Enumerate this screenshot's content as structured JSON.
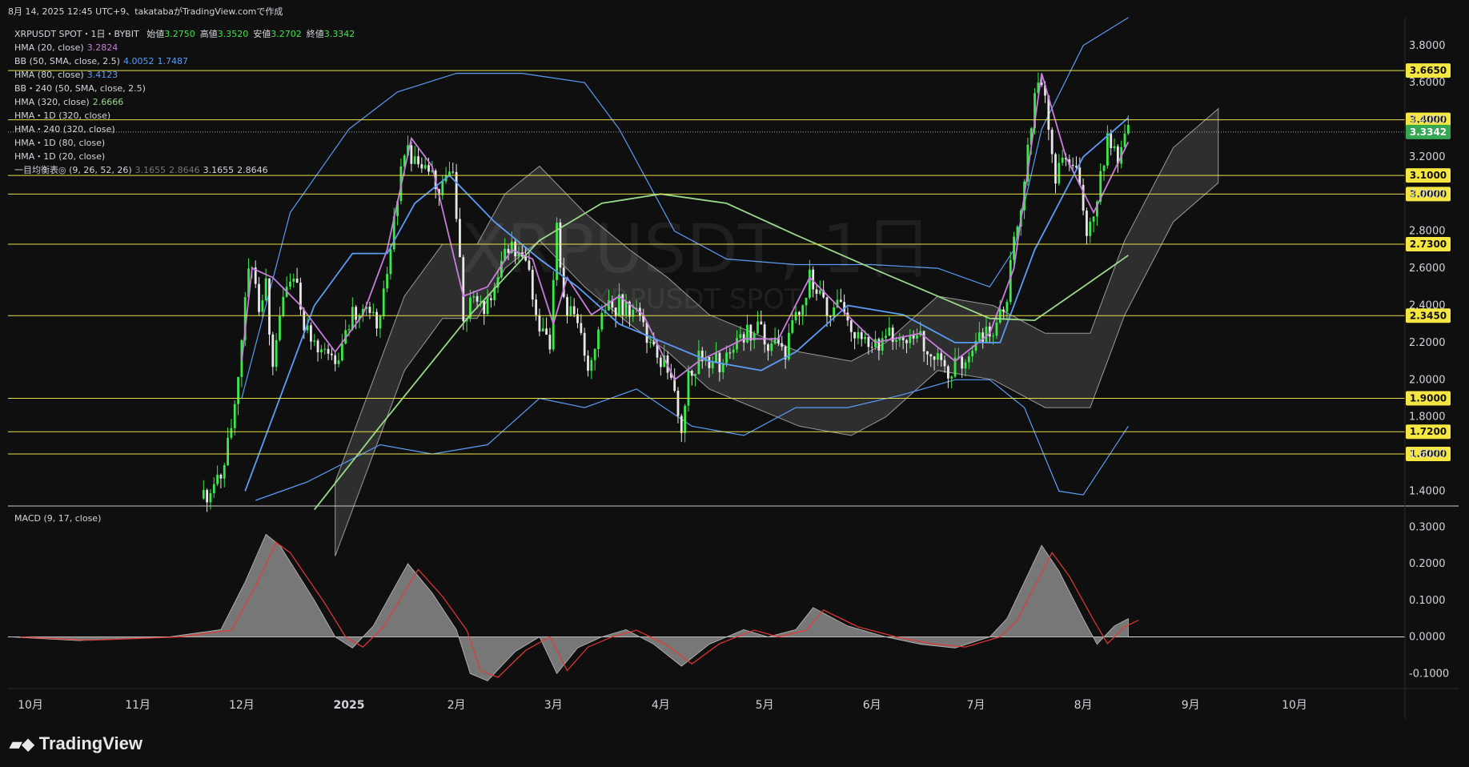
{
  "header": {
    "info_line": "8月 14, 2025 12:45 UTC+9、takatabaがTradingView.comで作成"
  },
  "legend": {
    "symbol": "XRPUSDT SPOT・1日・BYBIT",
    "ohlc": [
      {
        "label": "始値",
        "value": "3.2750"
      },
      {
        "label": "高値",
        "value": "3.3520"
      },
      {
        "label": "安値",
        "value": "3.2702"
      },
      {
        "label": "終値",
        "value": "3.3342"
      }
    ],
    "indicators": [
      {
        "label": "HMA (20, close)",
        "values": [
          "3.2824"
        ],
        "colors": [
          "#c77ddb"
        ]
      },
      {
        "label": "BB (50, SMA, close, 2.5)",
        "values": [
          "4.0052",
          "1.7487"
        ],
        "colors": [
          "#5b9cf6",
          "#5b9cf6"
        ]
      },
      {
        "label": "HMA (80, close)",
        "values": [
          "3.4123"
        ],
        "colors": [
          "#5b9cf6"
        ]
      },
      {
        "label": "BB・240 (50, SMA, close, 2.5)",
        "values": [],
        "colors": []
      },
      {
        "label": "HMA (320, close)",
        "values": [
          "2.6666"
        ],
        "colors": [
          "#9ad88a"
        ]
      },
      {
        "label": "HMA・1D (320, close)",
        "values": [],
        "colors": []
      },
      {
        "label": "HMA・240 (320, close)",
        "values": [],
        "colors": []
      },
      {
        "label": "HMA・1D (80, close)",
        "values": [],
        "colors": []
      },
      {
        "label": "HMA・1D (20, close)",
        "values": [],
        "colors": []
      },
      {
        "label": "一目均衡表◎ (9, 26, 52, 26)",
        "values": [
          "3.1655",
          "2.8646",
          "3.1655",
          "2.8646"
        ],
        "colors": [
          "#777777",
          "#777777",
          "#d1d4dc",
          "#d1d4dc"
        ]
      }
    ]
  },
  "watermark": {
    "main": "XRPUSDT, 1日",
    "sub": "XRPUSDT SPOT"
  },
  "macd": {
    "title": "MACD (9, 17, close)"
  },
  "brand": "TradingView",
  "colors": {
    "background": "#0f0f0f",
    "up_candle": "#3ce84a",
    "down_candle": "#e8e8e8",
    "hma20": "#c77ddb",
    "hma80": "#5b9cf6",
    "bb": "#5b9cf6",
    "hma320": "#9ad88a",
    "level_line": "#e8e04a",
    "level_tag_bg": "#f5e642",
    "last_price_bg": "#34a853",
    "macd_fill": "#8a8a8a",
    "macd_signal": "#e53935"
  },
  "chart_data": {
    "type": "candlestick",
    "symbol": "XRPUSDT SPOT",
    "interval": "1日",
    "exchange": "BYBIT",
    "y_range": [
      1.32,
      3.95
    ],
    "y_ticks": [
      "3.8000",
      "3.6000",
      "3.4000",
      "3.2000",
      "3.0000",
      "2.8000",
      "2.6000",
      "2.4000",
      "2.2000",
      "2.0000",
      "1.8000",
      "1.6000",
      "1.4000"
    ],
    "x_ticks": [
      {
        "label": "10月",
        "date": "2024-10-01",
        "bold": false
      },
      {
        "label": "11月",
        "date": "2024-11-01",
        "bold": false
      },
      {
        "label": "12月",
        "date": "2024-12-01",
        "bold": false
      },
      {
        "label": "2025",
        "date": "2025-01-01",
        "bold": true
      },
      {
        "label": "2月",
        "date": "2025-02-01",
        "bold": false
      },
      {
        "label": "3月",
        "date": "2025-03-01",
        "bold": false
      },
      {
        "label": "4月",
        "date": "2025-04-01",
        "bold": false
      },
      {
        "label": "5月",
        "date": "2025-05-01",
        "bold": false
      },
      {
        "label": "6月",
        "date": "2025-06-01",
        "bold": false
      },
      {
        "label": "7月",
        "date": "2025-07-01",
        "bold": false
      },
      {
        "label": "8月",
        "date": "2025-08-01",
        "bold": false
      },
      {
        "label": "9月",
        "date": "2025-09-01",
        "bold": false
      },
      {
        "label": "10月",
        "date": "2025-10-01",
        "bold": false
      }
    ],
    "levels": [
      "3.6650",
      "3.4000",
      "3.1000",
      "3.0000",
      "2.7300",
      "2.3450",
      "1.9000",
      "1.7200",
      "1.6000"
    ],
    "last_price": "3.3342",
    "close_path": [
      [
        "2024-11-20",
        1.36
      ],
      [
        "2024-11-24",
        1.45
      ],
      [
        "2024-11-28",
        1.7
      ],
      [
        "2024-12-02",
        2.45
      ],
      [
        "2024-12-04",
        2.65
      ],
      [
        "2024-12-06",
        2.35
      ],
      [
        "2024-12-08",
        2.5
      ],
      [
        "2024-12-10",
        2.1
      ],
      [
        "2024-12-13",
        2.4
      ],
      [
        "2024-12-16",
        2.55
      ],
      [
        "2024-12-19",
        2.3
      ],
      [
        "2024-12-22",
        2.2
      ],
      [
        "2024-12-26",
        2.15
      ],
      [
        "2024-12-29",
        2.08
      ],
      [
        "2025-01-02",
        2.35
      ],
      [
        "2025-01-06",
        2.4
      ],
      [
        "2025-01-09",
        2.3
      ],
      [
        "2025-01-12",
        2.55
      ],
      [
        "2025-01-15",
        3.0
      ],
      [
        "2025-01-17",
        3.25
      ],
      [
        "2025-01-20",
        3.15
      ],
      [
        "2025-01-24",
        3.1
      ],
      [
        "2025-01-27",
        3.05
      ],
      [
        "2025-01-31",
        3.08
      ],
      [
        "2025-02-02",
        2.6
      ],
      [
        "2025-02-03",
        2.35
      ],
      [
        "2025-02-06",
        2.45
      ],
      [
        "2025-02-10",
        2.4
      ],
      [
        "2025-02-13",
        2.55
      ],
      [
        "2025-02-16",
        2.7
      ],
      [
        "2025-02-19",
        2.68
      ],
      [
        "2025-02-22",
        2.55
      ],
      [
        "2025-02-25",
        2.25
      ],
      [
        "2025-02-28",
        2.15
      ],
      [
        "2025-03-02",
        2.85
      ],
      [
        "2025-03-04",
        2.4
      ],
      [
        "2025-03-08",
        2.3
      ],
      [
        "2025-03-11",
        2.05
      ],
      [
        "2025-03-14",
        2.3
      ],
      [
        "2025-03-18",
        2.4
      ],
      [
        "2025-03-22",
        2.4
      ],
      [
        "2025-03-26",
        2.35
      ],
      [
        "2025-03-30",
        2.15
      ],
      [
        "2025-04-03",
        2.05
      ],
      [
        "2025-04-07",
        1.75
      ],
      [
        "2025-04-09",
        2.05
      ],
      [
        "2025-04-13",
        2.12
      ],
      [
        "2025-04-18",
        2.08
      ],
      [
        "2025-04-23",
        2.2
      ],
      [
        "2025-04-28",
        2.28
      ],
      [
        "2025-05-02",
        2.2
      ],
      [
        "2025-05-07",
        2.15
      ],
      [
        "2025-05-11",
        2.4
      ],
      [
        "2025-05-14",
        2.55
      ],
      [
        "2025-05-18",
        2.4
      ],
      [
        "2025-05-22",
        2.38
      ],
      [
        "2025-05-27",
        2.28
      ],
      [
        "2025-06-01",
        2.18
      ],
      [
        "2025-06-05",
        2.22
      ],
      [
        "2025-06-10",
        2.25
      ],
      [
        "2025-06-15",
        2.22
      ],
      [
        "2025-06-20",
        2.15
      ],
      [
        "2025-06-23",
        2.05
      ],
      [
        "2025-06-27",
        2.1
      ],
      [
        "2025-07-02",
        2.2
      ],
      [
        "2025-07-07",
        2.28
      ],
      [
        "2025-07-10",
        2.45
      ],
      [
        "2025-07-12",
        2.78
      ],
      [
        "2025-07-14",
        2.95
      ],
      [
        "2025-07-17",
        3.4
      ],
      [
        "2025-07-18",
        3.55
      ],
      [
        "2025-07-21",
        3.55
      ],
      [
        "2025-07-24",
        3.1
      ],
      [
        "2025-07-27",
        3.2
      ],
      [
        "2025-07-30",
        3.1
      ],
      [
        "2025-08-02",
        2.8
      ],
      [
        "2025-08-05",
        3.0
      ],
      [
        "2025-08-08",
        3.3
      ],
      [
        "2025-08-11",
        3.2
      ],
      [
        "2025-08-14",
        3.33
      ]
    ],
    "series": [
      {
        "name": "HMA (20, close)",
        "points": [
          [
            "2024-12-01",
            2.1
          ],
          [
            "2024-12-04",
            2.6
          ],
          [
            "2024-12-10",
            2.55
          ],
          [
            "2024-12-18",
            2.4
          ],
          [
            "2024-12-28",
            2.15
          ],
          [
            "2025-01-05",
            2.35
          ],
          [
            "2025-01-12",
            2.7
          ],
          [
            "2025-01-19",
            3.3
          ],
          [
            "2025-01-25",
            3.15
          ],
          [
            "2025-02-03",
            2.45
          ],
          [
            "2025-02-10",
            2.5
          ],
          [
            "2025-02-17",
            2.7
          ],
          [
            "2025-02-23",
            2.65
          ],
          [
            "2025-03-01",
            2.3
          ],
          [
            "2025-03-05",
            2.55
          ],
          [
            "2025-03-12",
            2.35
          ],
          [
            "2025-03-20",
            2.45
          ],
          [
            "2025-03-27",
            2.35
          ],
          [
            "2025-04-05",
            2.0
          ],
          [
            "2025-04-12",
            2.1
          ],
          [
            "2025-04-25",
            2.22
          ],
          [
            "2025-05-05",
            2.22
          ],
          [
            "2025-05-14",
            2.55
          ],
          [
            "2025-05-22",
            2.4
          ],
          [
            "2025-06-02",
            2.2
          ],
          [
            "2025-06-15",
            2.25
          ],
          [
            "2025-06-25",
            2.1
          ],
          [
            "2025-07-05",
            2.25
          ],
          [
            "2025-07-12",
            2.6
          ],
          [
            "2025-07-20",
            3.65
          ],
          [
            "2025-07-27",
            3.2
          ],
          [
            "2025-08-04",
            2.9
          ],
          [
            "2025-08-14",
            3.28
          ]
        ]
      },
      {
        "name": "HMA (80, close)",
        "points": [
          [
            "2024-12-02",
            1.4
          ],
          [
            "2024-12-12",
            1.9
          ],
          [
            "2024-12-22",
            2.4
          ],
          [
            "2025-01-02",
            2.68
          ],
          [
            "2025-01-12",
            2.68
          ],
          [
            "2025-01-20",
            2.95
          ],
          [
            "2025-01-30",
            3.1
          ],
          [
            "2025-02-12",
            2.85
          ],
          [
            "2025-02-25",
            2.65
          ],
          [
            "2025-03-08",
            2.5
          ],
          [
            "2025-03-20",
            2.3
          ],
          [
            "2025-04-02",
            2.2
          ],
          [
            "2025-04-15",
            2.1
          ],
          [
            "2025-04-30",
            2.05
          ],
          [
            "2025-05-10",
            2.15
          ],
          [
            "2025-05-25",
            2.4
          ],
          [
            "2025-06-10",
            2.35
          ],
          [
            "2025-06-25",
            2.2
          ],
          [
            "2025-07-08",
            2.2
          ],
          [
            "2025-07-18",
            2.7
          ],
          [
            "2025-08-01",
            3.2
          ],
          [
            "2025-08-14",
            3.41
          ]
        ]
      },
      {
        "name": "HMA (320, close)",
        "points": [
          [
            "2024-12-22",
            1.3
          ],
          [
            "2025-01-10",
            1.75
          ],
          [
            "2025-02-05",
            2.35
          ],
          [
            "2025-02-25",
            2.75
          ],
          [
            "2025-03-15",
            2.95
          ],
          [
            "2025-04-01",
            3.0
          ],
          [
            "2025-04-20",
            2.95
          ],
          [
            "2025-05-10",
            2.78
          ],
          [
            "2025-06-01",
            2.6
          ],
          [
            "2025-06-20",
            2.45
          ],
          [
            "2025-07-05",
            2.33
          ],
          [
            "2025-07-18",
            2.32
          ],
          [
            "2025-08-01",
            2.5
          ],
          [
            "2025-08-14",
            2.67
          ]
        ]
      },
      {
        "name": "BB (50, SMA, close, 2.5) upper",
        "points": [
          [
            "2024-12-01",
            1.9
          ],
          [
            "2024-12-15",
            2.9
          ],
          [
            "2025-01-01",
            3.35
          ],
          [
            "2025-01-15",
            3.55
          ],
          [
            "2025-02-01",
            3.65
          ],
          [
            "2025-02-20",
            3.65
          ],
          [
            "2025-03-10",
            3.6
          ],
          [
            "2025-03-20",
            3.35
          ],
          [
            "2025-04-05",
            2.8
          ],
          [
            "2025-04-20",
            2.65
          ],
          [
            "2025-05-10",
            2.62
          ],
          [
            "2025-06-01",
            2.62
          ],
          [
            "2025-06-20",
            2.6
          ],
          [
            "2025-07-05",
            2.5
          ],
          [
            "2025-07-12",
            2.7
          ],
          [
            "2025-07-20",
            3.35
          ],
          [
            "2025-08-01",
            3.8
          ],
          [
            "2025-08-14",
            3.95
          ]
        ]
      },
      {
        "name": "BB (50, SMA, close, 2.5) lower",
        "points": [
          [
            "2024-12-05",
            1.35
          ],
          [
            "2024-12-20",
            1.45
          ],
          [
            "2025-01-10",
            1.65
          ],
          [
            "2025-01-25",
            1.6
          ],
          [
            "2025-02-10",
            1.65
          ],
          [
            "2025-02-25",
            1.9
          ],
          [
            "2025-03-10",
            1.85
          ],
          [
            "2025-03-25",
            1.95
          ],
          [
            "2025-04-10",
            1.75
          ],
          [
            "2025-04-25",
            1.7
          ],
          [
            "2025-05-10",
            1.85
          ],
          [
            "2025-05-25",
            1.85
          ],
          [
            "2025-06-10",
            1.92
          ],
          [
            "2025-06-25",
            2.0
          ],
          [
            "2025-07-05",
            2.0
          ],
          [
            "2025-07-15",
            1.85
          ],
          [
            "2025-07-25",
            1.4
          ],
          [
            "2025-08-01",
            1.38
          ],
          [
            "2025-08-14",
            1.75
          ]
        ]
      }
    ],
    "macd": {
      "y_ticks": [
        "0.3000",
        "0.2000",
        "0.1000",
        "0.0000",
        "-0.1000"
      ],
      "y_range": [
        -0.13,
        0.34
      ],
      "histogram": [
        [
          "2024-09-25",
          0.0
        ],
        [
          "2024-10-15",
          -0.01
        ],
        [
          "2024-11-10",
          0.0
        ],
        [
          "2024-11-25",
          0.02
        ],
        [
          "2024-12-02",
          0.15
        ],
        [
          "2024-12-08",
          0.28
        ],
        [
          "2024-12-12",
          0.25
        ],
        [
          "2024-12-22",
          0.1
        ],
        [
          "2024-12-28",
          0.0
        ],
        [
          "2025-01-02",
          -0.03
        ],
        [
          "2025-01-08",
          0.03
        ],
        [
          "2025-01-15",
          0.15
        ],
        [
          "2025-01-18",
          0.2
        ],
        [
          "2025-01-25",
          0.12
        ],
        [
          "2025-02-01",
          0.02
        ],
        [
          "2025-02-05",
          -0.1
        ],
        [
          "2025-02-10",
          -0.12
        ],
        [
          "2025-02-18",
          -0.04
        ],
        [
          "2025-02-25",
          0.0
        ],
        [
          "2025-03-02",
          -0.1
        ],
        [
          "2025-03-08",
          -0.03
        ],
        [
          "2025-03-15",
          0.0
        ],
        [
          "2025-03-22",
          0.02
        ],
        [
          "2025-03-30",
          -0.02
        ],
        [
          "2025-04-07",
          -0.08
        ],
        [
          "2025-04-15",
          -0.02
        ],
        [
          "2025-04-25",
          0.02
        ],
        [
          "2025-05-02",
          0.0
        ],
        [
          "2025-05-10",
          0.02
        ],
        [
          "2025-05-15",
          0.08
        ],
        [
          "2025-05-25",
          0.03
        ],
        [
          "2025-06-05",
          0.0
        ],
        [
          "2025-06-15",
          -0.02
        ],
        [
          "2025-06-25",
          -0.03
        ],
        [
          "2025-07-05",
          0.0
        ],
        [
          "2025-07-10",
          0.05
        ],
        [
          "2025-07-15",
          0.15
        ],
        [
          "2025-07-20",
          0.25
        ],
        [
          "2025-07-25",
          0.18
        ],
        [
          "2025-08-01",
          0.05
        ],
        [
          "2025-08-05",
          -0.02
        ],
        [
          "2025-08-10",
          0.03
        ],
        [
          "2025-08-14",
          0.05
        ]
      ]
    }
  }
}
